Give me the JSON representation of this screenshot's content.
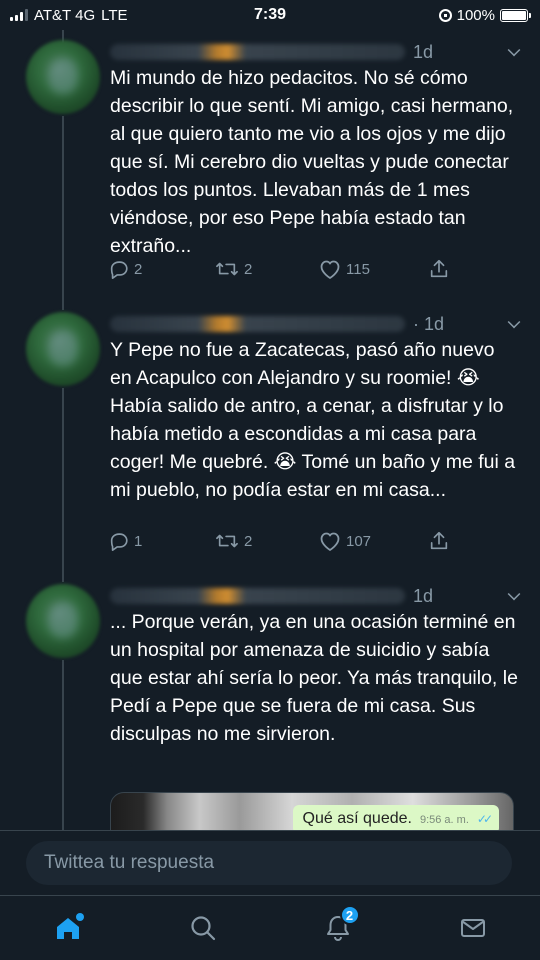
{
  "status_bar": {
    "carrier": "AT&T 4G",
    "network": "LTE",
    "time": "7:39",
    "battery": "100%"
  },
  "tweets": [
    {
      "date": "1d",
      "text": "Mi mundo de hizo pedacitos. No sé cómo describir lo que sentí. Mi amigo, casi hermano, al que quiero tanto me vio a los ojos y me dijo que sí. Mi cerebro dio vueltas y pude conectar todos los puntos. Llevaban más de 1 mes viéndose, por eso Pepe había estado tan extraño...",
      "replies": "2",
      "retweets": "2",
      "likes": "115"
    },
    {
      "date": "· 1d",
      "text": "Y Pepe no fue a Zacatecas, pasó año nuevo en Acapulco con Alejandro y su roomie! 😭 Había salido de antro, a cenar, a disfrutar y lo había metido a escondidas a mi casa para coger! Me quebré. 😭 Tomé un baño y me fui a mi pueblo, no podía estar en mi casa...",
      "replies": "1",
      "retweets": "2",
      "likes": "107"
    },
    {
      "date": "1d",
      "text": "... Porque verán, ya en una ocasión terminé en un hospital por amenaza de suicidio y sabía que estar ahí sería lo peor. Ya más tranquilo, le Pedí a Pepe que se fuera de mi casa. Sus disculpas no me sirvieron.",
      "replies": "",
      "retweets": "",
      "likes": "",
      "media": {
        "bubble_text": "Qué así quede.",
        "bubble_time": "9:56 a. m."
      }
    }
  ],
  "reply_bar": {
    "placeholder": "Twittea tu respuesta"
  },
  "nav": {
    "notifications_badge": "2",
    "items": [
      "home-icon",
      "search-icon",
      "notifications-icon",
      "messages-icon"
    ]
  },
  "colors": {
    "background": "#141d26",
    "text": "#ffffff",
    "secondary": "#8899a6",
    "accent": "#1da1f2",
    "divider": "#38444d"
  }
}
